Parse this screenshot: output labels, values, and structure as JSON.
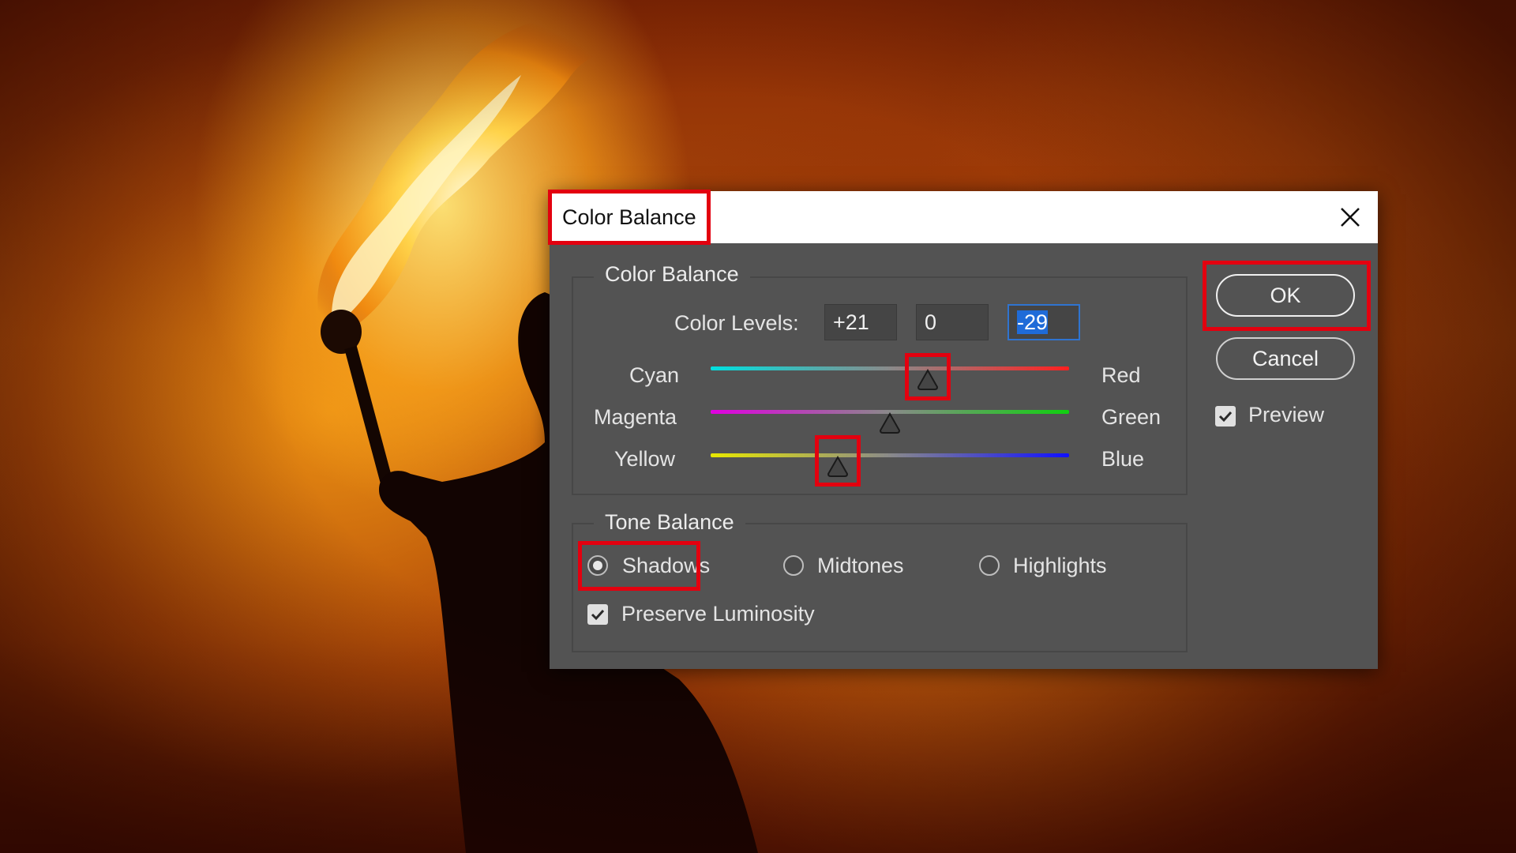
{
  "dialog": {
    "title": "Color Balance",
    "close_label": "close",
    "color_balance_group": {
      "legend": "Color Balance",
      "levels_label": "Color Levels:",
      "levels": [
        "+21",
        "0",
        "-29"
      ],
      "sliders": [
        {
          "left": "Cyan",
          "right": "Red",
          "value": 21
        },
        {
          "left": "Magenta",
          "right": "Green",
          "value": 0
        },
        {
          "left": "Yellow",
          "right": "Blue",
          "value": -29
        }
      ]
    },
    "tone_group": {
      "legend": "Tone Balance",
      "options": [
        "Shadows",
        "Midtones",
        "Highlights"
      ],
      "selected": "Shadows",
      "preserve_luminosity": {
        "label": "Preserve Luminosity",
        "checked": true
      }
    },
    "buttons": {
      "ok": "OK",
      "cancel": "Cancel"
    },
    "preview": {
      "label": "Preview",
      "checked": true
    }
  },
  "colors": {
    "highlight": "#e3000f",
    "dialog_bg": "#535353",
    "input_focus": "#2f74d0",
    "selection": "#1f6bd8"
  }
}
